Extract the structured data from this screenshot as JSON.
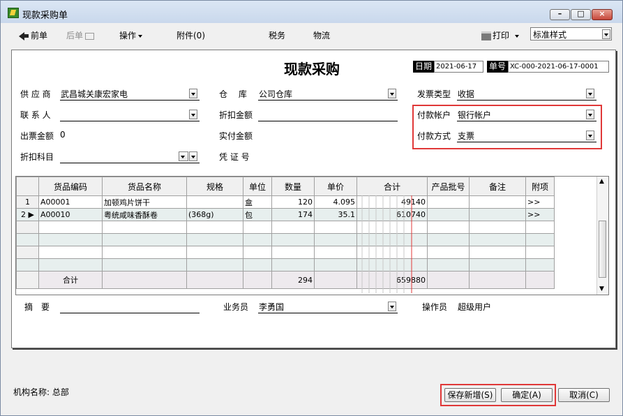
{
  "window": {
    "title": "现款采购单"
  },
  "toolbar": {
    "prev": "前单",
    "next": "后单",
    "operations": "操作",
    "attachments": "附件(0)",
    "tax": "税务",
    "logistics": "物流",
    "print": "打印",
    "style_value": "标准样式"
  },
  "document": {
    "title": "现款采购",
    "date_label": "日期",
    "date_value": "2021-06-17",
    "number_label": "单号",
    "number_value": "XC-000-2021-06-17-0001"
  },
  "form": {
    "supplier_label": "供 应 商",
    "supplier_value": "武昌城关康宏家电",
    "warehouse_label": "仓　 库",
    "warehouse_value": "公司仓库",
    "invoice_type_label": "发票类型",
    "invoice_type_value": "收据",
    "contact_label": "联 系 人",
    "contact_value": "",
    "discount_amount_label": "折扣金额",
    "discount_amount_value": "",
    "pay_account_label": "付款帐户",
    "pay_account_value": "银行帐户",
    "invoice_amount_label": "出票金额",
    "invoice_amount_value": "0",
    "actual_pay_label": "实付金额",
    "actual_pay_value": "",
    "pay_method_label": "付款方式",
    "pay_method_value": "支票",
    "discount_subject_label": "折扣科目",
    "voucher_label": "凭 证 号"
  },
  "grid": {
    "columns": [
      "货品编码",
      "货品名称",
      "规格",
      "单位",
      "数量",
      "单价",
      "合计",
      "产品批号",
      "备注",
      "附项"
    ],
    "rows": [
      {
        "num": "1",
        "code": "A00001",
        "name": "加顿鸡片饼干",
        "spec": "",
        "unit": "盒",
        "qty": "120",
        "price": "4.095",
        "total": "49140",
        "attach": ">>"
      },
      {
        "num": "2",
        "code": "A00010",
        "name": "粤统咸味香酥卷",
        "spec": "(368g)",
        "unit": "包",
        "qty": "174",
        "price": "35.1",
        "total": "610740",
        "attach": ">>"
      }
    ],
    "sum_label": "合计",
    "sum_qty": "294",
    "sum_total": "659880"
  },
  "bottom": {
    "summary_label": "摘　要",
    "salesman_label": "业务员",
    "salesman_value": "李勇国",
    "operator_label": "操作员",
    "operator_value": "超级用户"
  },
  "footer": {
    "org_label": "机构名称: 总部",
    "save_new": "保存新增(S)",
    "confirm": "确定(A)",
    "cancel": "取消(C)"
  }
}
